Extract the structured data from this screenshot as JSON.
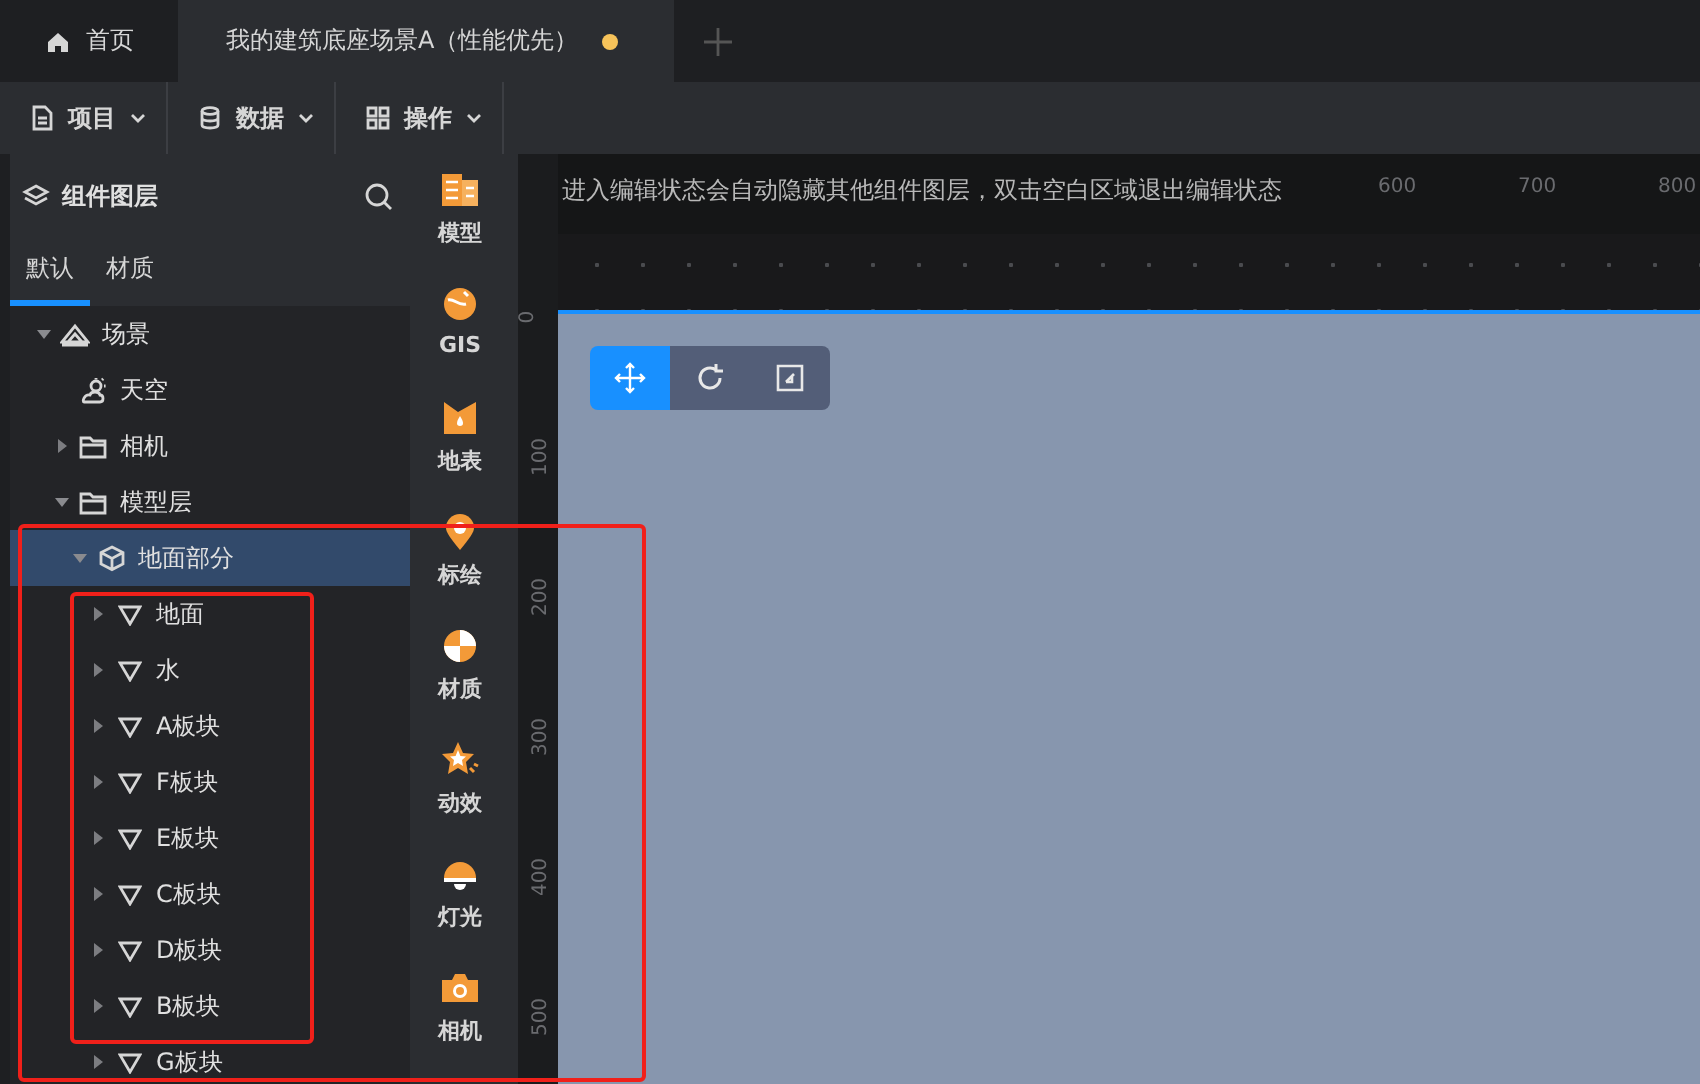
{
  "tabs": [
    {
      "label": "首页",
      "kind": "home",
      "selected": false,
      "unsaved": false
    },
    {
      "label": "我的建筑底座场景A（性能优先）",
      "kind": "document",
      "selected": true,
      "unsaved": true
    }
  ],
  "menus": [
    {
      "label": "项目",
      "kind": "file"
    },
    {
      "label": "数据",
      "kind": "database"
    },
    {
      "label": "操作",
      "kind": "grid"
    }
  ],
  "layers_panel": {
    "title": "组件图层",
    "tabs": [
      {
        "label": "默认",
        "selected": true
      },
      {
        "label": "材质",
        "selected": false
      }
    ],
    "tree": [
      {
        "label": "场景",
        "kind": "scene",
        "expandable": true,
        "expanded": true,
        "selected": false,
        "children": [
          {
            "label": "天空",
            "kind": "sky",
            "expandable": false,
            "selected": false
          },
          {
            "label": "相机",
            "kind": "folder",
            "expandable": true,
            "expanded": false,
            "selected": false
          },
          {
            "label": "模型层",
            "kind": "folder",
            "expandable": true,
            "expanded": true,
            "selected": false,
            "children": [
              {
                "label": "地面部分",
                "kind": "group",
                "expandable": true,
                "expanded": true,
                "selected": true,
                "children": [
                  {
                    "label": "地面",
                    "kind": "mesh",
                    "expandable": true,
                    "expanded": false,
                    "selected": false
                  },
                  {
                    "label": "水",
                    "kind": "mesh",
                    "expandable": true,
                    "expanded": false,
                    "selected": false
                  },
                  {
                    "label": "A板块",
                    "kind": "mesh",
                    "expandable": true,
                    "expanded": false,
                    "selected": false
                  },
                  {
                    "label": "F板块",
                    "kind": "mesh",
                    "expandable": true,
                    "expanded": false,
                    "selected": false
                  },
                  {
                    "label": "E板块",
                    "kind": "mesh",
                    "expandable": true,
                    "expanded": false,
                    "selected": false
                  },
                  {
                    "label": "C板块",
                    "kind": "mesh",
                    "expandable": true,
                    "expanded": false,
                    "selected": false
                  },
                  {
                    "label": "D板块",
                    "kind": "mesh",
                    "expandable": true,
                    "expanded": false,
                    "selected": false
                  },
                  {
                    "label": "B板块",
                    "kind": "mesh",
                    "expandable": true,
                    "expanded": false,
                    "selected": false
                  },
                  {
                    "label": "G板块",
                    "kind": "mesh",
                    "expandable": true,
                    "expanded": false,
                    "selected": false
                  }
                ]
              }
            ]
          }
        ]
      }
    ]
  },
  "tool_strip": [
    {
      "label": "模型",
      "kind": "model"
    },
    {
      "label": "GIS",
      "kind": "gis"
    },
    {
      "label": "地表",
      "kind": "surface"
    },
    {
      "label": "标绘",
      "kind": "marker"
    },
    {
      "label": "材质",
      "kind": "material"
    },
    {
      "label": "动效",
      "kind": "effect"
    },
    {
      "label": "灯光",
      "kind": "light"
    },
    {
      "label": "相机",
      "kind": "camera"
    }
  ],
  "canvas": {
    "hint": "进入编辑状态会自动隐藏其他组件图层，双击空白区域退出编辑状态",
    "top_ruler_labels": [
      "600",
      "700",
      "800"
    ],
    "left_ruler_labels": [
      "0",
      "100",
      "200",
      "300",
      "400",
      "500"
    ],
    "transform_tools": [
      {
        "kind": "move",
        "selected": true
      },
      {
        "kind": "rotate",
        "selected": false
      },
      {
        "kind": "scale",
        "selected": false
      }
    ]
  }
}
